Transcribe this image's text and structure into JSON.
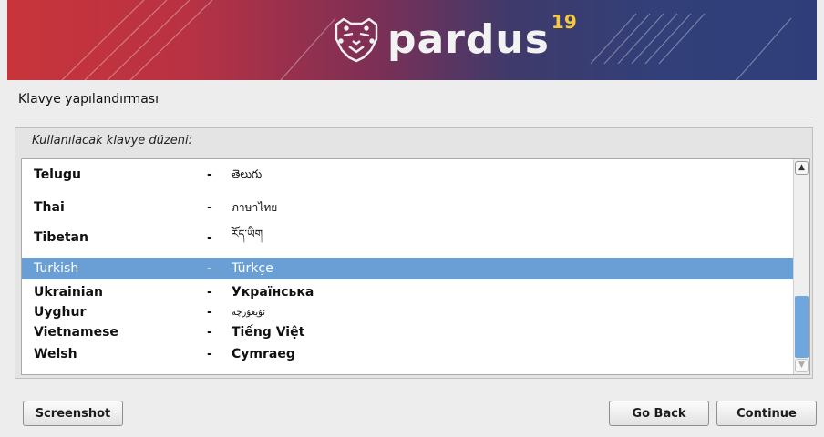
{
  "banner": {
    "brand": "pardus",
    "version": "19"
  },
  "title": "Klavye yapılandırması",
  "prompt": "Kullanılacak klavye düzeni:",
  "list": {
    "items": [
      {
        "name": "Telugu",
        "native": "తెలుగు"
      },
      {
        "name": "Thai",
        "native": "ภาษาไทย"
      },
      {
        "name": "Tibetan",
        "native": "རོད་ཡིག"
      },
      {
        "name": "Turkish",
        "native": "Türkçe",
        "selected": true
      },
      {
        "name": "Ukrainian",
        "native": "Українська"
      },
      {
        "name": "Uyghur",
        "native": "ئۇيغۇرچە"
      },
      {
        "name": "Vietnamese",
        "native": "Tiếng Việt"
      },
      {
        "name": "Welsh",
        "native": "Cymraeg"
      }
    ],
    "separator": "-"
  },
  "buttons": {
    "screenshot": "Screenshot",
    "go_back": "Go Back",
    "continue": "Continue"
  },
  "colors": {
    "selection": "#6a9fd6",
    "version_accent": "#f5c842"
  }
}
